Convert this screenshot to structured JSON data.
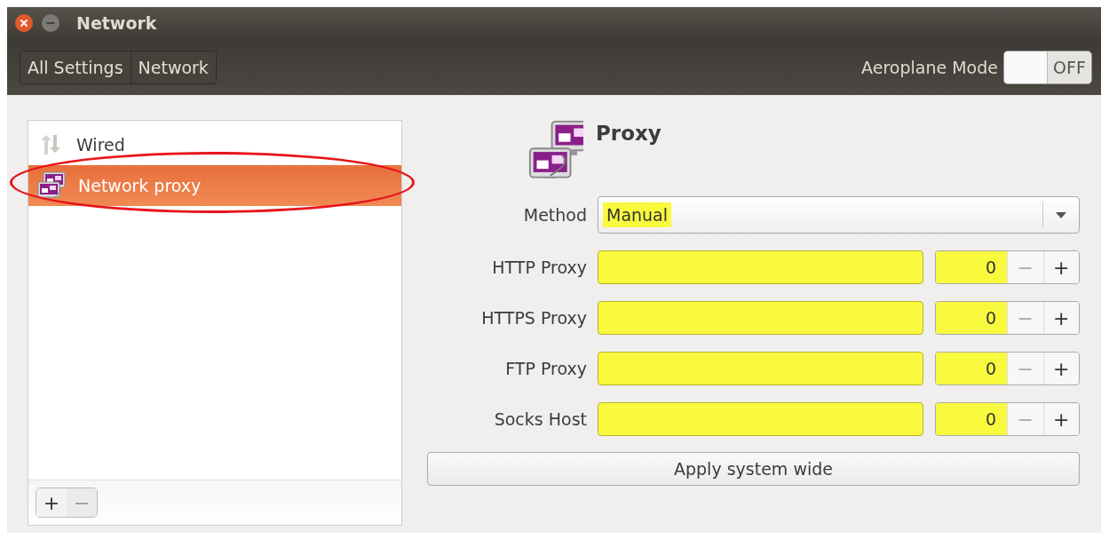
{
  "window": {
    "title": "Network"
  },
  "toolbar": {
    "breadcrumbs": [
      {
        "label": "All Settings"
      },
      {
        "label": "Network"
      }
    ],
    "aeroplane_mode": {
      "label": "Aeroplane Mode",
      "on": false,
      "state_text": "OFF"
    }
  },
  "sidebar": {
    "items": [
      {
        "label": "Wired",
        "kind": "wired",
        "selected": false,
        "circled": false
      },
      {
        "label": "Network proxy",
        "kind": "proxy",
        "selected": true,
        "circled": true
      }
    ],
    "add_button": {
      "label": "+",
      "disabled": false
    },
    "remove_button": {
      "label": "−",
      "disabled": true
    }
  },
  "panel": {
    "title": "Proxy",
    "method": {
      "label": "Method",
      "value": "Manual",
      "highlighted": true
    },
    "proxies": [
      {
        "label": "HTTP Proxy",
        "host_highlighted": true,
        "port": "0",
        "port_highlighted": true,
        "decrement": "−",
        "decrement_disabled": true,
        "increment": "+"
      },
      {
        "label": "HTTPS Proxy",
        "host_highlighted": true,
        "port": "0",
        "port_highlighted": true,
        "decrement": "−",
        "decrement_disabled": true,
        "increment": "+"
      },
      {
        "label": "FTP Proxy",
        "host_highlighted": true,
        "port": "0",
        "port_highlighted": true,
        "decrement": "−",
        "decrement_disabled": true,
        "increment": "+"
      },
      {
        "label": "Socks Host",
        "host_highlighted": true,
        "port": "0",
        "port_highlighted": true,
        "decrement": "−",
        "decrement_disabled": true,
        "increment": "+"
      }
    ],
    "apply_button": "Apply system wide"
  }
}
